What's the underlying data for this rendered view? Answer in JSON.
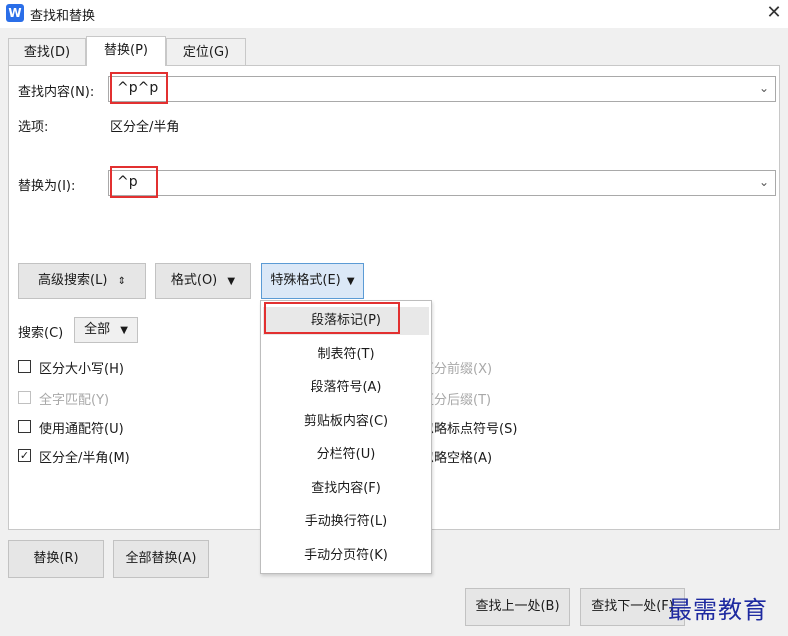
{
  "window": {
    "title": "查找和替换",
    "app_icon_letter": "W",
    "close_glyph": "✕"
  },
  "tabs": [
    {
      "label": "查找(D)",
      "active": false
    },
    {
      "label": "替换(P)",
      "active": true
    },
    {
      "label": "定位(G)",
      "active": false
    }
  ],
  "find": {
    "label": "查找内容(N):",
    "value": "^p^p"
  },
  "options": {
    "label": "选项:",
    "value": "区分全/半角"
  },
  "replace": {
    "label": "替换为(I):",
    "value": "^p"
  },
  "buttons": {
    "advanced": "高级搜索(L)",
    "advanced_icon": "⇕",
    "format": "格式(O)",
    "special": "特殊格式(E)",
    "dropdown_glyph": "▼"
  },
  "search": {
    "label": "搜索(C)",
    "value": "全部"
  },
  "checkboxes_left": [
    {
      "label": "区分大小写(H)",
      "checked": false,
      "disabled": false
    },
    {
      "label": "全字匹配(Y)",
      "checked": false,
      "disabled": true
    },
    {
      "label": "使用通配符(U)",
      "checked": false,
      "disabled": false
    },
    {
      "label": "区分全/半角(M)",
      "checked": true,
      "disabled": false
    }
  ],
  "checkboxes_right": [
    {
      "label": "区分前缀(X)",
      "disabled": true
    },
    {
      "label": "区分后缀(T)",
      "disabled": true
    },
    {
      "label": "忽略标点符号(S)",
      "disabled": false
    },
    {
      "label": "忽略空格(A)",
      "disabled": false
    }
  ],
  "special_menu": [
    "段落标记(P)",
    "制表符(T)",
    "段落符号(A)",
    "剪贴板内容(C)",
    "分栏符(U)",
    "查找内容(F)",
    "手动换行符(L)",
    "手动分页符(K)"
  ],
  "bottom_buttons": {
    "replace": "替换(R)",
    "replace_all": "全部替换(A)",
    "find_prev": "查找上一处(B)",
    "find_next": "查找下一处(F)"
  },
  "watermark": "最需教育",
  "colors": {
    "highlight_box": "#e23030",
    "icon_blue": "#2a6ee8",
    "watermark": "#1e2aa0"
  }
}
